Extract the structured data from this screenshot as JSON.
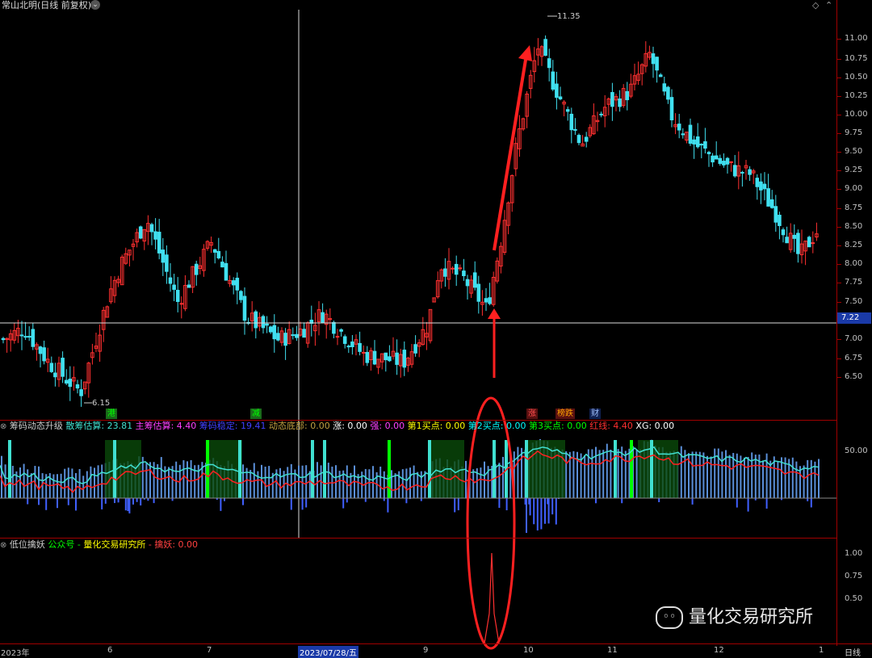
{
  "main_pane": {
    "title": "常山北明(日线 前复权)",
    "price_labels": [
      "11.00",
      "10.75",
      "10.50",
      "10.25",
      "10.00",
      "9.75",
      "9.50",
      "9.25",
      "9.00",
      "8.75",
      "8.50",
      "8.25",
      "8.00",
      "7.75",
      "7.50",
      "7.25",
      "7.00",
      "6.75",
      "6.50"
    ],
    "current_price": "7.22",
    "high_marker": "11.35",
    "low_marker": "6.15"
  },
  "badges": [
    {
      "text": "港",
      "color": "#00ff00",
      "bg": "#1a6a1a"
    },
    {
      "text": "减",
      "color": "#00ff00",
      "bg": "#1a6a1a"
    },
    {
      "text": "涨",
      "color": "#ff5050",
      "bg": "#5a1010"
    },
    {
      "text": "榜跌",
      "color": "#ffa500",
      "bg": "#5a1010"
    },
    {
      "text": "财",
      "color": "#a0c0ff",
      "bg": "#102050"
    }
  ],
  "indicator1": {
    "name": "筹码动态升级",
    "items": [
      {
        "label": "散筹估算: 23.81",
        "color": "#40e0d0"
      },
      {
        "label": "主筹估算: 4.40",
        "color": "#ff40ff"
      },
      {
        "label": "筹码稳定: 19.41",
        "color": "#4040ff"
      },
      {
        "label": "动态底部: 0.00",
        "color": "#c0a040"
      },
      {
        "label": "涨: 0.00",
        "color": "#ffffff"
      },
      {
        "label": "强: 0.00",
        "color": "#ff40ff"
      },
      {
        "label": "第1买点: 0.00",
        "color": "#ffff00"
      },
      {
        "label": "第2买点: 0.00",
        "color": "#00ffff"
      },
      {
        "label": "第3买点: 0.00",
        "color": "#00ff00"
      },
      {
        "label": "红线: 4.40",
        "color": "#ff3030"
      },
      {
        "label": "XG: 0.00",
        "color": "#ffffff"
      }
    ],
    "axis_label": "50.00"
  },
  "indicator2": {
    "name": "低位擒妖",
    "items": [
      {
        "label": "公众号 - ",
        "color": "#00ff00"
      },
      {
        "label": "量化交易研究所",
        "color": "#ffff00"
      },
      {
        "label": " - 擒妖: 0.00",
        "color": "#ff4040"
      }
    ],
    "axis_labels": [
      "1.00",
      "0.75",
      "0.50"
    ]
  },
  "x_axis": {
    "labels": [
      "2023年",
      "6",
      "7",
      "2023/07/28/五",
      "9",
      "10",
      "11",
      "12",
      "1"
    ],
    "period_button": "日线"
  },
  "watermark": "量化交易研究所",
  "colors": {
    "up": "#ff3030",
    "down": "#40e0f0",
    "frame": "#a00000",
    "annotation": "#ff2020"
  }
}
